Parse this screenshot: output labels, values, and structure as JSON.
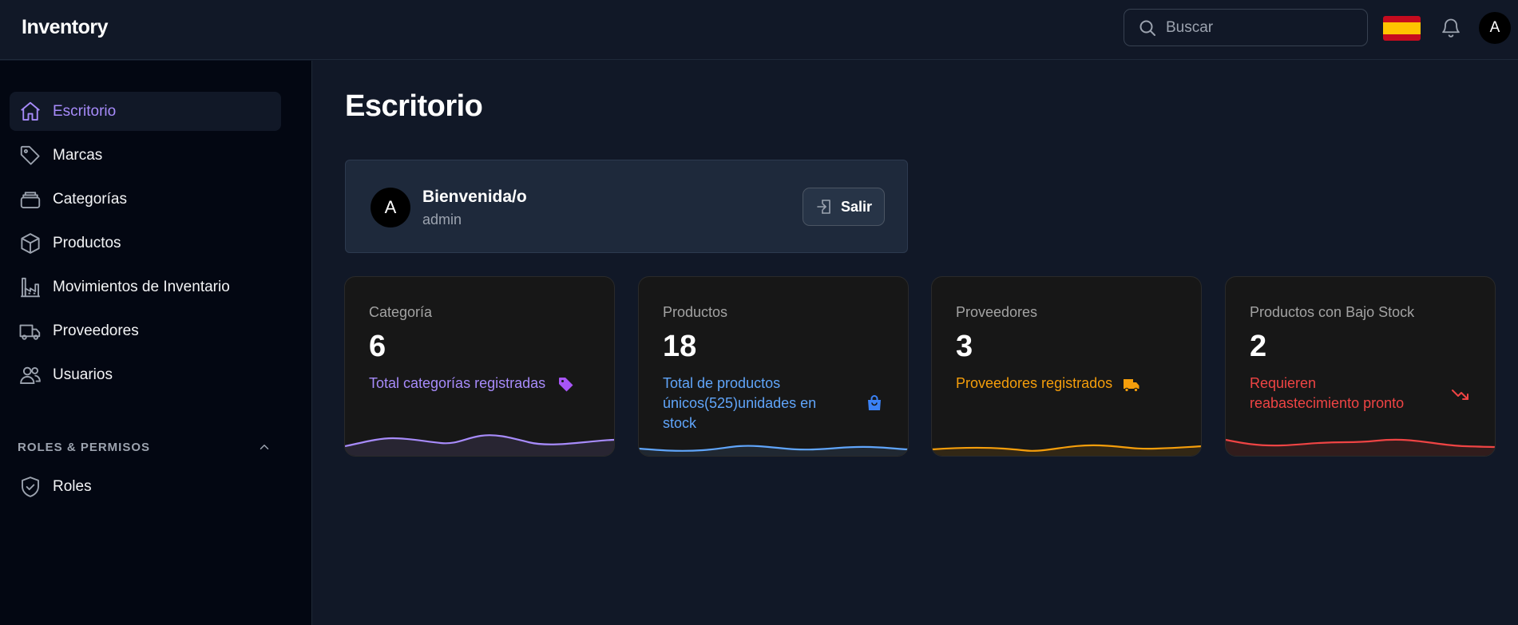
{
  "app": {
    "title": "Inventory"
  },
  "header": {
    "search_placeholder": "Buscar",
    "user_initial": "A",
    "flag": "spain-flag"
  },
  "sidebar": {
    "items": [
      {
        "label": "Escritorio",
        "icon": "home-icon",
        "active": true
      },
      {
        "label": "Marcas",
        "icon": "tag-icon"
      },
      {
        "label": "Categorías",
        "icon": "box-stack-icon"
      },
      {
        "label": "Productos",
        "icon": "cube-icon"
      },
      {
        "label": "Movimientos de Inventario",
        "icon": "factory-icon"
      },
      {
        "label": "Proveedores",
        "icon": "truck-icon"
      },
      {
        "label": "Usuarios",
        "icon": "users-icon"
      }
    ],
    "section": {
      "label": "ROLES & PERMISOS",
      "expanded": true
    },
    "section_items": [
      {
        "label": "Roles",
        "icon": "shield-check-icon"
      }
    ]
  },
  "main": {
    "title": "Escritorio",
    "welcome": {
      "avatar_initial": "A",
      "title": "Bienvenida/o",
      "subtitle": "admin",
      "logout_label": "Salir"
    },
    "cards": [
      {
        "label": "Categoría",
        "value": "6",
        "desc": "Total categorías registradas",
        "color": "#a78bfa",
        "icon": "tag-icon"
      },
      {
        "label": "Productos",
        "value": "18",
        "desc": "Total de productos únicos(525)unidades en stock",
        "color": "#60a5fa",
        "icon": "shopping-bag-icon"
      },
      {
        "label": "Proveedores",
        "value": "3",
        "desc": "Proveedores registrados",
        "color": "#f59e0b",
        "icon": "truck-icon"
      },
      {
        "label": "Productos con Bajo Stock",
        "value": "2",
        "desc": "Requieren reabastecimiento pronto",
        "color": "#ef4444",
        "icon": "trending-down-icon"
      }
    ]
  },
  "colors": {
    "accent": "#a78bfa",
    "background": "#111827",
    "sidebar": "#030712",
    "card": "#171717"
  }
}
